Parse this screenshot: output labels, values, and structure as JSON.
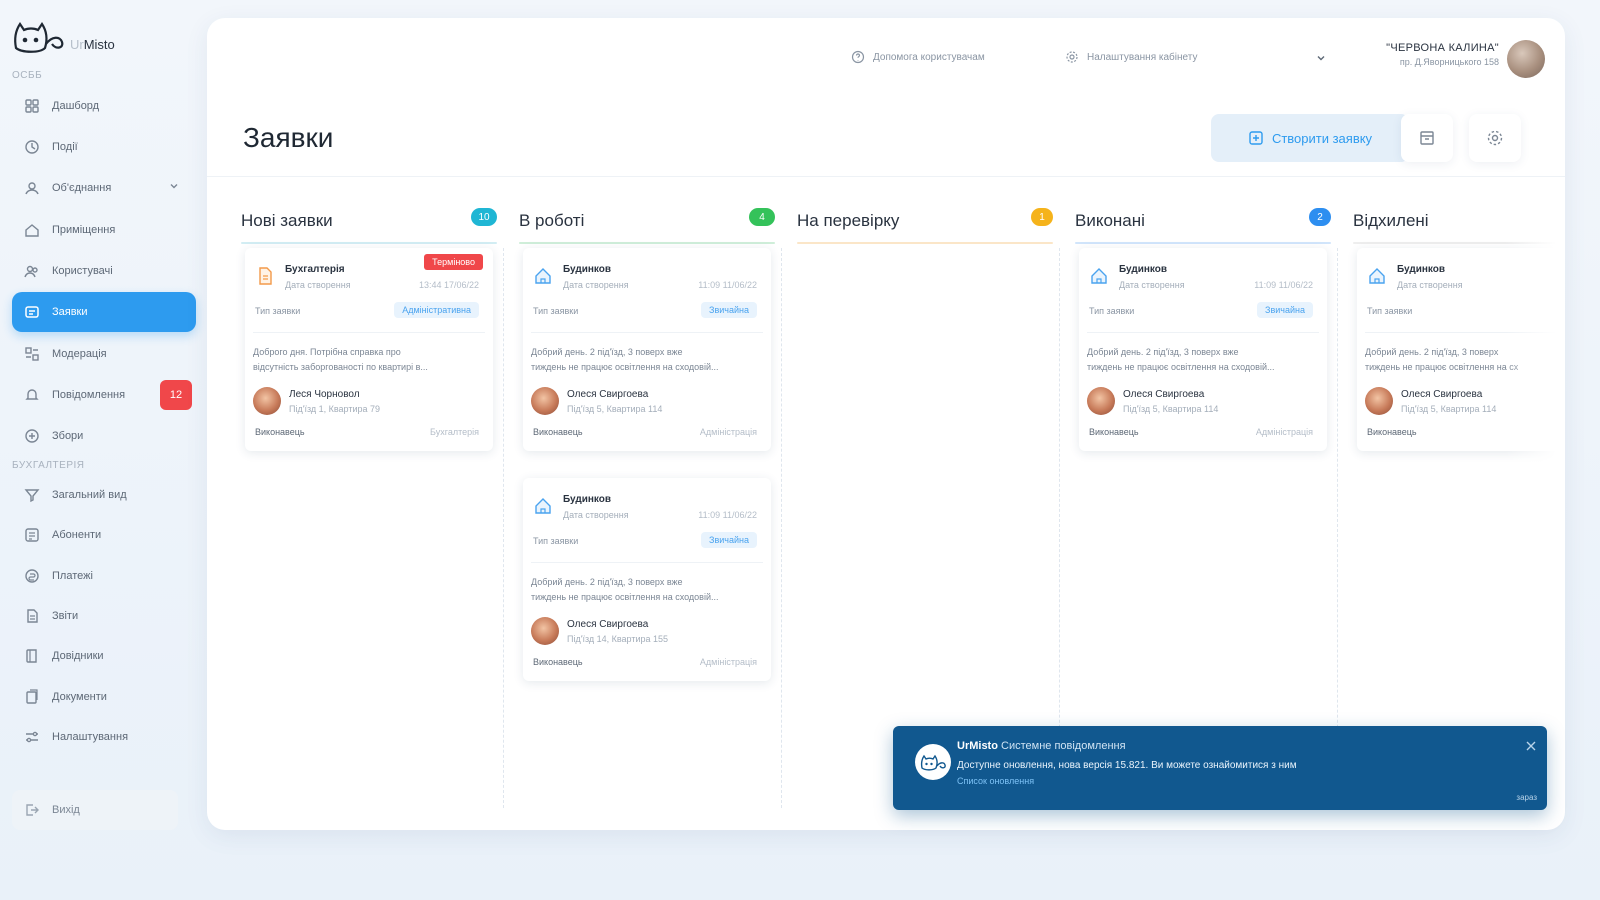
{
  "brand": {
    "prefix": "Ur",
    "name": "Misto"
  },
  "sidebar": {
    "section1": "ОСББ",
    "section2": "БУХГАЛТЕРІЯ",
    "items": [
      {
        "label": "Дашборд",
        "icon": "dashboard-icon"
      },
      {
        "label": "Події",
        "icon": "events-icon"
      },
      {
        "label": "Об'єднання",
        "icon": "association-icon"
      },
      {
        "label": "Приміщення",
        "icon": "premises-icon"
      },
      {
        "label": "Користувачі",
        "icon": "users-icon"
      },
      {
        "label": "Заявки",
        "icon": "requests-icon"
      },
      {
        "label": "Модерація",
        "icon": "moderation-icon"
      },
      {
        "label": "Повідомлення",
        "icon": "messages-icon",
        "badge": "12"
      },
      {
        "label": "Збори",
        "icon": "meetings-icon"
      },
      {
        "label": "Загальний вид",
        "icon": "overview-icon"
      },
      {
        "label": "Абоненти",
        "icon": "subscribers-icon"
      },
      {
        "label": "Платежі",
        "icon": "payments-icon"
      },
      {
        "label": "Звіти",
        "icon": "reports-icon"
      },
      {
        "label": "Довідники",
        "icon": "directories-icon"
      },
      {
        "label": "Документи",
        "icon": "documents-icon"
      },
      {
        "label": "Налаштування",
        "icon": "settings-icon"
      }
    ],
    "logout": "Вихід"
  },
  "topbar": {
    "help": "Допомога користувачам",
    "settings": "Налаштування кабінету",
    "user_name": "\"ЧЕРВОНА КАЛИНА\"",
    "user_addr": "пр. Д.Яворницького 158"
  },
  "page": {
    "title": "Заявки",
    "create_label": "Створити заявку"
  },
  "colors": {
    "accent": "#2d9bef",
    "new": "#1fb6d4",
    "work": "#34c25a",
    "review": "#f5b31b",
    "done": "#2d8ef0",
    "urgent": "#f0474a"
  },
  "columns": [
    {
      "title": "Нові заявки",
      "count": "10",
      "color": "#1fb6d4",
      "line": "#d2edf3"
    },
    {
      "title": "В роботі",
      "count": "4",
      "color": "#34c25a",
      "line": "#cfeed9"
    },
    {
      "title": "На перевірку",
      "count": "1",
      "color": "#f5b31b",
      "line": "#fbe6c8"
    },
    {
      "title": "Виконані",
      "count": "2",
      "color": "#2d8ef0",
      "line": "#d1e5fb"
    },
    {
      "title": "Відхилені",
      "count": "",
      "color": "#cccccc",
      "line": "#eeeeee"
    }
  ],
  "cards": {
    "new1": {
      "category": "Бухгалтерія",
      "date_label": "Дата створення",
      "date": "13:44 17/06/22",
      "type_label": "Тип заявки",
      "tag": "Адміністративна",
      "urgent": "Терміново",
      "text1": "Доброго дня. Потрібна справка про",
      "text2": "відсутність заборгованості по квартирі в...",
      "person": "Леся Чорновол",
      "address": "Під'їзд 1, Квартира 79",
      "executor": "Виконавець",
      "executor_value": "Бухгалтерія"
    },
    "work1": {
      "category": "Будинков",
      "date_label": "Дата створення",
      "date": "11:09 11/06/22",
      "type_label": "Тип заявки",
      "tag": "Звичайна",
      "text1": "Добрий день. 2 під'їзд, 3 поверх вже",
      "text2": "тиждень не працює освітлення на сходовій...",
      "person": "Олеся Свиргоева",
      "address": "Під'їзд 5, Квартира 114",
      "executor": "Виконавець",
      "executor_value": "Адміністрація"
    },
    "work2": {
      "category": "Будинков",
      "date_label": "Дата створення",
      "date": "11:09 11/06/22",
      "type_label": "Тип заявки",
      "tag": "Звичайна",
      "text1": "Добрий день. 2 під'їзд, 3 поверх вже",
      "text2": "тиждень не працює освітлення на сходовій...",
      "person": "Олеся Свиргоева",
      "address": "Під'їзд 14, Квартира 155",
      "executor": "Виконавець",
      "executor_value": "Адміністрація"
    },
    "done1": {
      "category": "Будинков",
      "date_label": "Дата створення",
      "date": "11:09 11/06/22",
      "type_label": "Тип заявки",
      "tag": "Звичайна",
      "text1": "Добрий день. 2 під'їзд, 3 поверх вже",
      "text2": "тиждень не працює освітлення на сходовій...",
      "person": "Олеся Свиргоева",
      "address": "Під'їзд 5, Квартира 114",
      "executor": "Виконавець",
      "executor_value": "Адміністрація"
    },
    "rej1": {
      "category": "Будинков",
      "date_label": "Дата створення",
      "type_label": "Тип заявки",
      "text1": "Добрий день. 2 під'їзд, 3 поверх",
      "text2": "тиждень не працює освітлення на сх",
      "person": "Олеся Свиргоева",
      "address": "Під'їзд 5, Квартира 114",
      "executor": "Виконавець"
    }
  },
  "toast": {
    "brand": "UrMisto",
    "title": "Системне повідомлення",
    "message": "Доступне оновлення, нова версія 15.821. Ви можете ознайомитися з ним",
    "link": "Список оновлення",
    "time": "зараз"
  }
}
